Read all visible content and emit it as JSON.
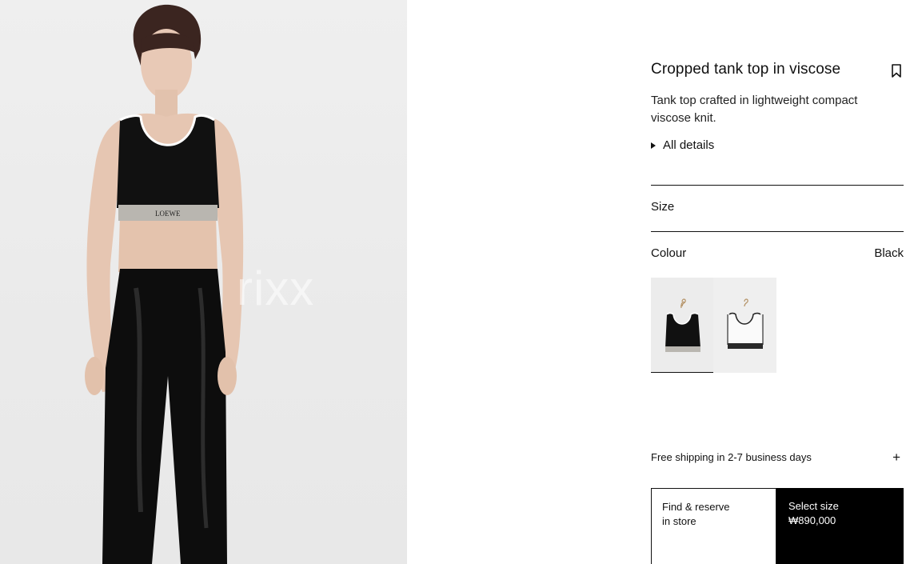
{
  "product": {
    "title": "Cropped tank top in viscose",
    "description": "Tank top crafted in lightweight compact viscose knit.",
    "details_label": "All details",
    "brand_band_text": "LOEWE"
  },
  "size": {
    "label": "Size"
  },
  "colour": {
    "label": "Colour",
    "selected": "Black",
    "swatches": [
      {
        "name": "Black",
        "selected": true
      },
      {
        "name": "White",
        "selected": false
      }
    ]
  },
  "shipping": {
    "label": "Free shipping in 2-7 business days"
  },
  "actions": {
    "find_store_line1": "Find & reserve",
    "find_store_line2": "in store",
    "select_size": "Select size",
    "price": "₩890,000"
  },
  "watermark": "rixx",
  "icons": [
    "bookmark-icon",
    "triangle-right-icon",
    "plus-icon"
  ]
}
